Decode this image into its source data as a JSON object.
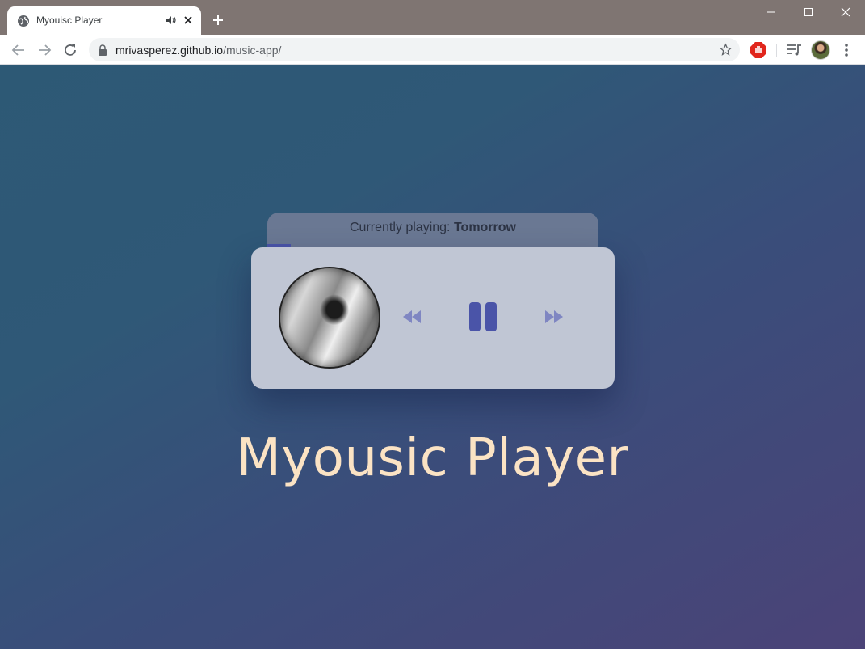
{
  "browser": {
    "tab_title": "Myouisc Player",
    "url_host": "mrivasperez.github.io",
    "url_path": "/music-app/"
  },
  "player": {
    "now_playing_label": "Currently playing: ",
    "track_title": "Tomorrow",
    "progress_fraction": 0.07,
    "state": "playing"
  },
  "page": {
    "app_title": "Myousic Player"
  },
  "colors": {
    "accent": "#4a54a8",
    "title": "#fbe3c4",
    "controls_muted": "#7f86c2"
  },
  "icons": {
    "prev": "rewind-icon",
    "pause": "pause-icon",
    "next": "fast-forward-icon"
  }
}
